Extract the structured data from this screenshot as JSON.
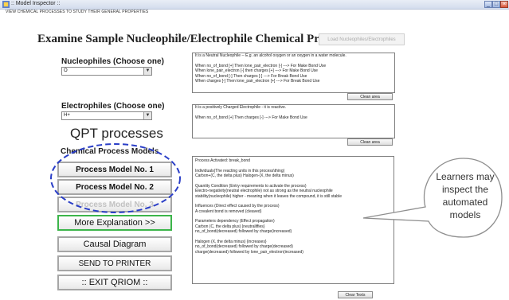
{
  "window": {
    "title": ":: Model Inspector ::",
    "subtitle": "VIEW CHEMICAL PROCESSES TO STUDY THEIR GENERAL PROPERTIES",
    "minimize_label": "_",
    "maximize_label": "□",
    "close_label": "×"
  },
  "header": {
    "title": "Examine Sample Nucleophile/Electrophile Chemical Properties",
    "load_button": "Load Nucleophiles/Electrophiles"
  },
  "nucleophiles": {
    "label": "Nucleophiles (Choose one)",
    "selected": "O",
    "description_lines": [
      "It is a Neutral Nucleophile -- E.g. an alcohol oxygen or an oxygen in a water molecule.",
      "",
      "When  no_of_bond [+]  Then  lone_pair_electron [-]        ---> For Make Bond Use",
      "When  lone_pair_electron [-]  then  charges [+]          ---> For Make Bond Use",
      "When  no_of_bond [-]  Then  charges [-]    ---> For Break Bond Use",
      "When  charges [-]  Then  lone_pair_electron [+]        ---> For Break Bond Use"
    ],
    "clean_button": "Clean area"
  },
  "electrophiles": {
    "label": "Electrophiles (Choose one)",
    "selected": "H+",
    "description_lines": [
      "It is a positively Charged Electrophile - it is reactive.",
      "",
      "When  no_of_bond [+]  Then  charges [-]        ---> For Make Bond Use"
    ],
    "clean_button": "Clean area"
  },
  "qpt": {
    "heading": "QPT  processes",
    "subheading": "Chemical Process Models"
  },
  "buttons": {
    "process_1": "Process Model No. 1",
    "process_2": "Process Model No. 2",
    "process_3": "Process Model No. 3",
    "more_explanation": "More Explanation >>",
    "causal_diagram": "Causal Diagram",
    "send_to_printer": "SEND TO PRINTER",
    "exit": ":: EXIT QRIOM ::"
  },
  "output": {
    "lines": [
      "Process Activated: break_bond",
      "",
      "Individuals(The reacting units in this process\\thing)",
      "   Carbon+(C, the delta plus)      Halogen-(X, the delta minus)",
      "",
      "Quantity Condition (Entry requirements to activate the process)",
      "   Electro-negativity(neutral electrophile) not as strong as the neutral nucleophile",
      "   stability(nucleophile) higher - meaning when it leaves the compound, it is still stable",
      "",
      "Influences (Direct effect caused by the process)",
      "   A covalent bond is removed (cleaved)",
      "",
      "Parameters dependency (Effect propagation)",
      "Carbon (C, the delta plus)      {neutraliffies}",
      "   no_of_bond(decreased)  followed by  charge(increased)",
      "",
      "Halogen (X, the delta minus)   {increases}",
      "   no_of_bond(decreased)  followed by  charge(decreased)",
      "   charge(decreased)  followed by  lone_pair_electron(increased)"
    ],
    "clear_button": "Clear Texts"
  },
  "callout": {
    "text": "Learners may inspect the automated models"
  },
  "colors": {
    "dashed_ellipse": "#2a3ec7",
    "green_border": "#3cb54a",
    "titlebar": "#d3dced"
  }
}
